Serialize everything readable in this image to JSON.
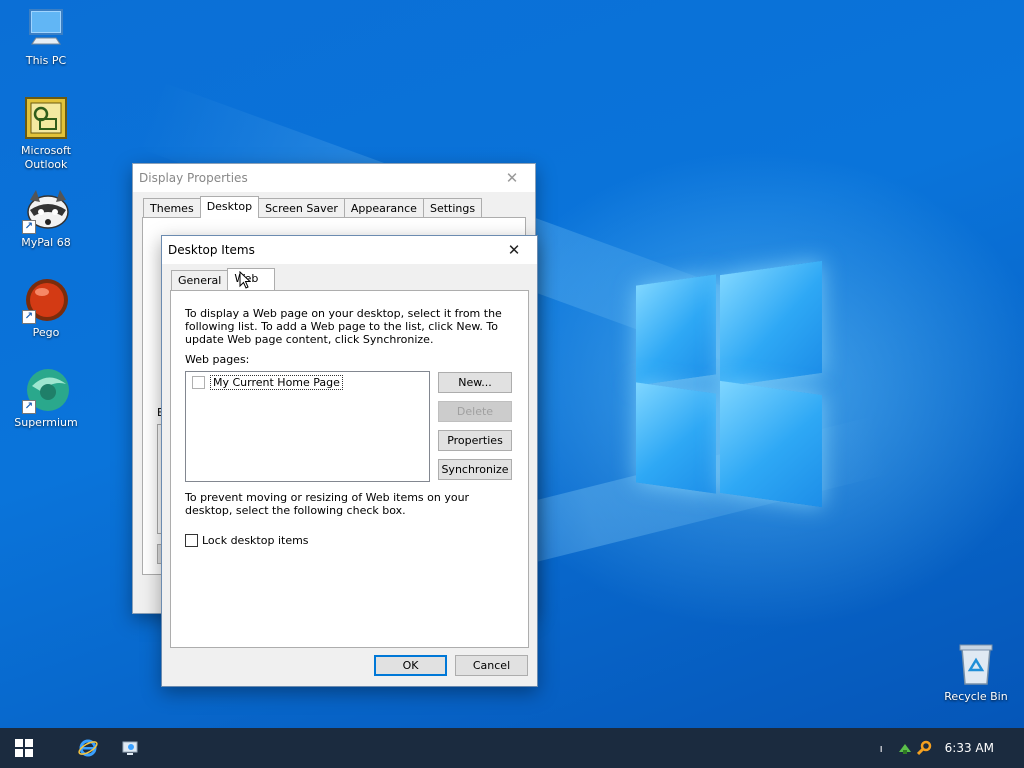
{
  "desktop": {
    "icons": [
      {
        "label": "This PC"
      },
      {
        "label": "Microsoft Outlook"
      },
      {
        "label": "MyPal 68"
      },
      {
        "label": "Pego"
      },
      {
        "label": "Supermium"
      },
      {
        "label": "Recycle Bin"
      }
    ]
  },
  "display_properties": {
    "title": "Display Properties",
    "tabs": [
      "Themes",
      "Desktop",
      "Screen Saver",
      "Appearance",
      "Settings"
    ],
    "active_tab": "Desktop",
    "partial_label": "B"
  },
  "desktop_items": {
    "title": "Desktop Items",
    "tabs": [
      "General",
      "Web"
    ],
    "active_tab": "Web",
    "intro_text": "To display a Web page on your desktop, select it from the following list. To add a Web page to the list, click New.  To update Web page content, click Synchronize.",
    "web_pages_label": "Web pages:",
    "web_pages": [
      {
        "label": "My Current Home Page",
        "checked": false
      }
    ],
    "buttons": {
      "new": "New...",
      "delete": "Delete",
      "properties": "Properties",
      "synchronize": "Synchronize"
    },
    "lock_text": "To prevent moving or resizing of Web items on your desktop, select the following check box.",
    "lock_label": "Lock desktop items",
    "lock_checked": false,
    "ok": "OK",
    "cancel": "Cancel"
  },
  "taskbar": {
    "clock": "6:33 AM",
    "tray_text": "ı"
  },
  "colors": {
    "accent": "#0078d7",
    "taskbar": "#1b2b3f"
  }
}
